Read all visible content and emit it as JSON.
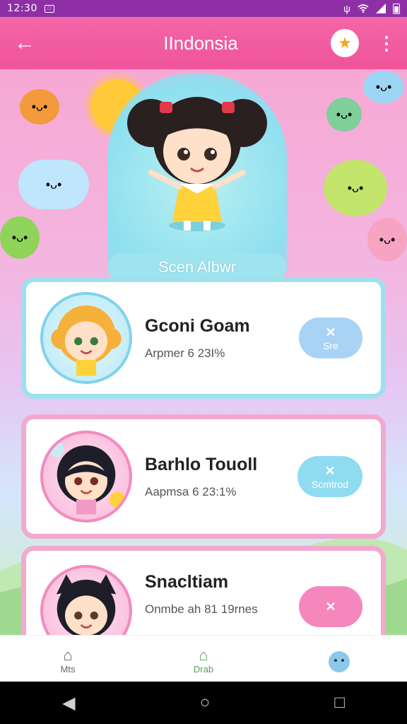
{
  "status_bar": {
    "time": "12:30",
    "sim_glyph": "□",
    "icons": [
      "vibrate-icon",
      "wifi-icon",
      "signal-icon",
      "battery-icon"
    ]
  },
  "app_bar": {
    "back_glyph": "←",
    "title": "IIndonsia",
    "mascot_glyph": "★",
    "more_glyph": "⋮"
  },
  "hero": {
    "label": "Scen Albwr"
  },
  "cards": [
    {
      "name": "Gconi Goam",
      "meta": "Arpmer 6 23I%",
      "action_glyph": "✕",
      "action_label": "Sre"
    },
    {
      "name": "Barhlo Touoll",
      "meta": "Aapmsa 6 23:1%",
      "action_glyph": "✕",
      "action_label": "Scmtrod"
    },
    {
      "name": "Snacltiam",
      "meta": "Onmbe ah 81 19rnes",
      "action_glyph": "✕",
      "action_label": ""
    }
  ],
  "bottom_nav": [
    {
      "label": "Mts",
      "icon": "home-icon",
      "glyph": "⌂"
    },
    {
      "label": "Drab",
      "icon": "house-icon",
      "glyph": "⌂"
    }
  ],
  "system_nav": {
    "back_glyph": "◀",
    "home_glyph": "○",
    "recents_glyph": "□"
  },
  "colors": {
    "status_bar": "#8f2fa6",
    "app_bar": "#f0539a",
    "card1_border": "#9ee0ef",
    "card_pink_border": "#f2a9d0",
    "active_nav": "#5a9a5a"
  }
}
